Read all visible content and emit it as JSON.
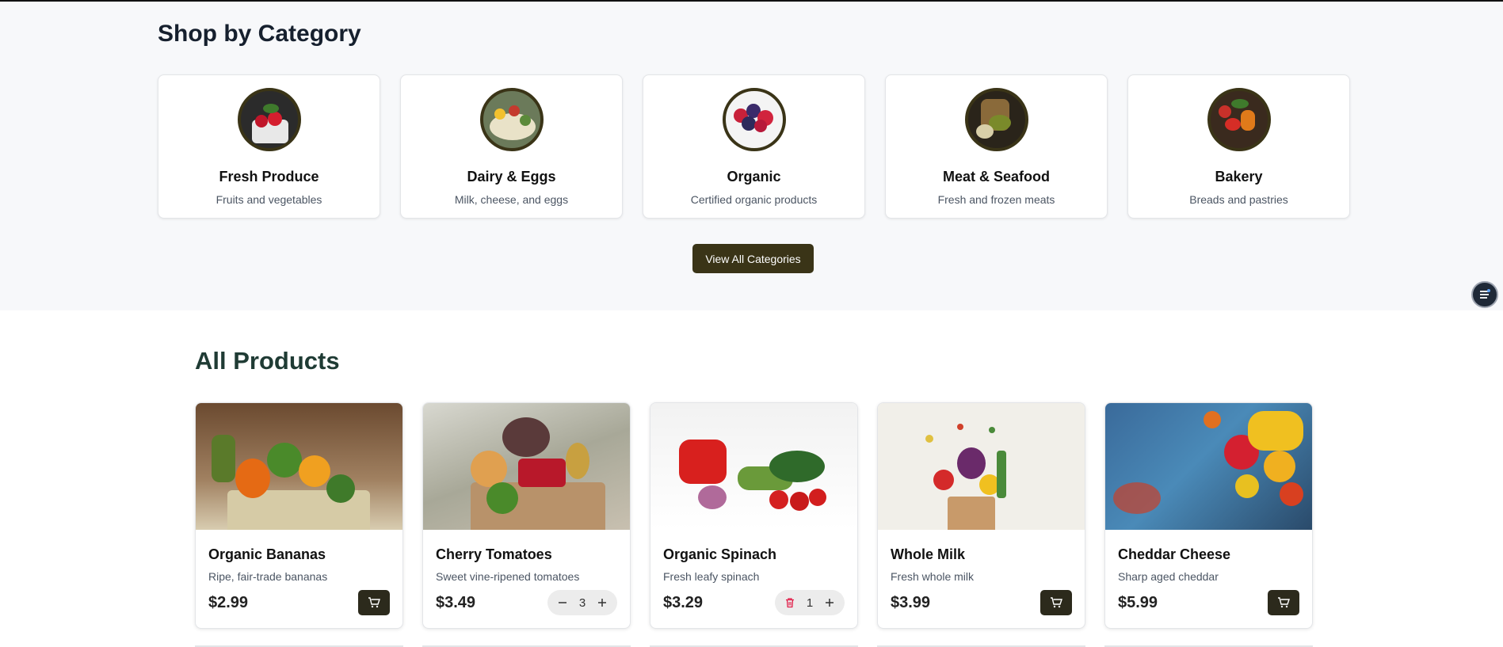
{
  "categories_section": {
    "title": "Shop by Category",
    "view_all_label": "View All Categories",
    "items": [
      {
        "name": "Fresh Produce",
        "description": "Fruits and vegetables"
      },
      {
        "name": "Dairy & Eggs",
        "description": "Milk, cheese, and eggs"
      },
      {
        "name": "Organic",
        "description": "Certified organic products"
      },
      {
        "name": "Meat & Seafood",
        "description": "Fresh and frozen meats"
      },
      {
        "name": "Bakery",
        "description": "Breads and pastries"
      }
    ]
  },
  "products_section": {
    "title": "All Products",
    "items": [
      {
        "name": "Organic Bananas",
        "description": "Ripe, fair-trade bananas",
        "price": "$2.99",
        "action": "add-to-cart"
      },
      {
        "name": "Cherry Tomatoes",
        "description": "Sweet vine-ripened tomatoes",
        "price": "$3.49",
        "action": "stepper",
        "quantity": "3"
      },
      {
        "name": "Organic Spinach",
        "description": "Fresh leafy spinach",
        "price": "$3.29",
        "action": "stepper-delete",
        "quantity": "1"
      },
      {
        "name": "Whole Milk",
        "description": "Fresh whole milk",
        "price": "$3.99",
        "action": "add-to-cart"
      },
      {
        "name": "Cheddar Cheese",
        "description": "Sharp aged cheddar",
        "price": "$5.99",
        "action": "add-to-cart"
      }
    ]
  },
  "icons": {
    "cart": "shopping-cart-icon",
    "minus": "minus-icon",
    "plus": "plus-icon",
    "trash": "trash-icon",
    "floating": "menu-list-icon"
  },
  "colors": {
    "accent_dark": "#3a3417",
    "cart_button": "#2c2a1c",
    "products_title": "#1f3b34",
    "delete_red": "#e11d48"
  }
}
